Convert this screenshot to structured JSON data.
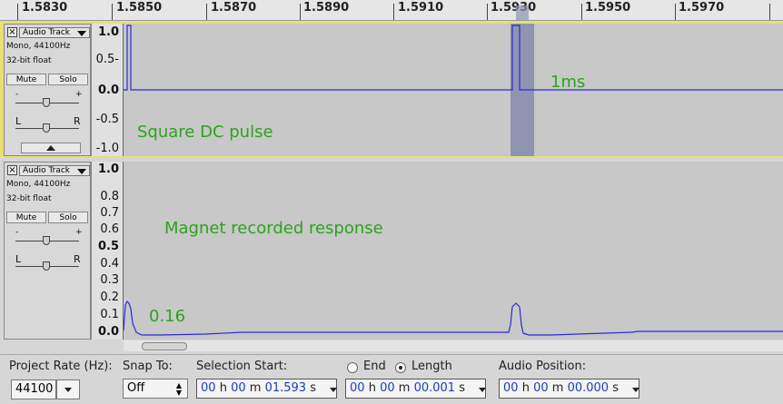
{
  "ruler": {
    "ticks": [
      "1.5830",
      "1.5850",
      "1.5870",
      "1.5890",
      "1.5910",
      "1.5930",
      "1.5950",
      "1.5970"
    ]
  },
  "tracks": [
    {
      "name": "Audio Track",
      "info_rate": "Mono, 44100Hz",
      "info_format": "32-bit float",
      "mute": "Mute",
      "solo": "Solo",
      "gain_minus": "-",
      "gain_plus": "+",
      "pan_left": "L",
      "pan_right": "R",
      "y_labels": [
        "1.0",
        "0.5-",
        "0.0",
        "-0.5",
        "-1.0"
      ],
      "annotation": "Square DC pulse",
      "annotation2": "1ms"
    },
    {
      "name": "Audio Track",
      "info_rate": "Mono, 44100Hz",
      "info_format": "32-bit float",
      "mute": "Mute",
      "solo": "Solo",
      "gain_minus": "-",
      "gain_plus": "+",
      "pan_left": "L",
      "pan_right": "R",
      "y_labels": [
        "1.0",
        "0.8",
        "0.7",
        "0.6",
        "0.5",
        "0.4",
        "0.3",
        "0.2",
        "0.1",
        "0.0"
      ],
      "annotation": "Magnet recorded response",
      "annotation2": "0.16"
    }
  ],
  "bottom": {
    "project_rate_label": "Project Rate (Hz):",
    "project_rate_value": "44100",
    "snap_label": "Snap To:",
    "snap_value": "Off",
    "selection_start_label": "Selection Start:",
    "end_label": "End",
    "length_label": "Length",
    "audio_position_label": "Audio Position:",
    "selection_start": {
      "h": "00",
      "m": "00",
      "s": "01.593"
    },
    "length": {
      "h": "00",
      "m": "00",
      "s": "00.001"
    },
    "audio_position": {
      "h": "00",
      "m": "00",
      "s": "00.000"
    },
    "unit_h": "h",
    "unit_m": "m",
    "unit_s": "s"
  },
  "colors": {
    "waveform": "#2a2ad8",
    "annotation": "#2aa41a",
    "selection": "#8f94b0"
  }
}
